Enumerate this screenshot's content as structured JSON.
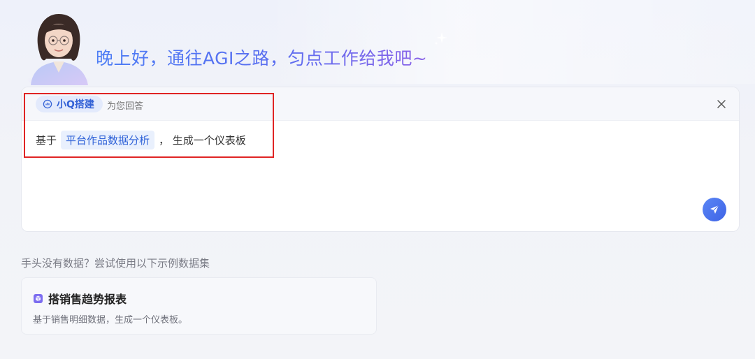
{
  "greeting": "晚上好，通往AGI之路，匀点工作给我吧~",
  "agent": {
    "name": "小Q搭建",
    "suffix": "为您回答"
  },
  "prompt": {
    "prefix": "基于",
    "slot": "平台作品数据分析",
    "suffix": "，  生成一个仪表板"
  },
  "dataset_hint": "手头没有数据？尝试使用以下示例数据集",
  "sample": {
    "title": "搭销售趋势报表",
    "description": "基于销售明细数据，生成一个仪表板。"
  },
  "icons": {
    "avatar": "assistant-avatar",
    "agent": "chart-bubble-icon",
    "close": "close-icon",
    "send": "send-icon",
    "sample": "cube-icon",
    "sparkle": "sparkle-icon"
  },
  "colors": {
    "accent": "#3563d6",
    "highlight": "#e02424",
    "send": "#4a72ee",
    "sample_icon": "#7b6cf0"
  }
}
